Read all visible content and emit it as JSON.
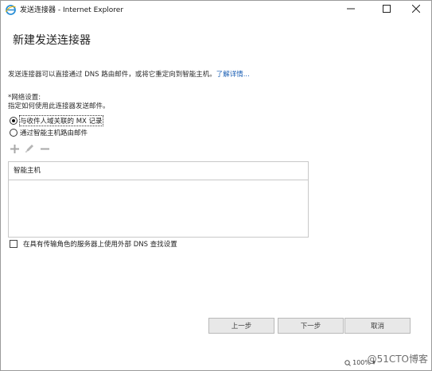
{
  "window": {
    "title": "发送连接器 - Internet Explorer"
  },
  "page": {
    "title": "新建发送连接器",
    "description": "发送连接器可以直接通过 DNS 路由邮件，或将它重定向到智能主机。",
    "learn_more": "了解详情..."
  },
  "network": {
    "label": "*网络设置:",
    "hint": "指定如何使用此连接器发送邮件。",
    "options": [
      {
        "label": "与收件人域关联的 MX 记录",
        "checked": true
      },
      {
        "label": "通过智能主机路由邮件",
        "checked": false
      }
    ]
  },
  "toolbar": {
    "icons": [
      "add-icon",
      "edit-icon",
      "remove-icon"
    ]
  },
  "smart_host_list": {
    "header": "智能主机",
    "rows": []
  },
  "dns_checkbox": {
    "label": "在具有传输角色的服务器上使用外部 DNS 查找设置",
    "checked": false
  },
  "buttons": {
    "back": "上一步",
    "next": "下一步",
    "cancel": "取消"
  },
  "footer": {
    "zoom": "100%",
    "watermark": "@51CTO博客"
  },
  "colors": {
    "link": "#1b5fb4",
    "button_bg": "#e8e8e8",
    "border": "#c8c8c8"
  }
}
